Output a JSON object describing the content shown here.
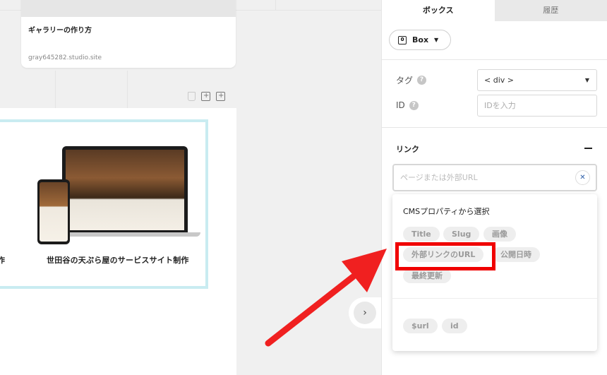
{
  "canvas": {
    "gallery_card": {
      "title": "ギャラリーの作り方",
      "url": "gray645282.studio.site"
    },
    "project": {
      "caption": "世田谷の天ぷら屋のサービスサイト制作",
      "caption_cut": "作"
    },
    "icons": [
      "trash-icon",
      "duplicate-icon",
      "add-icon"
    ],
    "next_button_glyph": "›"
  },
  "panel": {
    "tabs": [
      {
        "label": "ボックス",
        "active": true
      },
      {
        "label": "履歴",
        "active": false
      }
    ],
    "element_type": {
      "icon_glyph": "0",
      "label": "Box"
    },
    "tag": {
      "label": "タグ",
      "value": "< div >"
    },
    "id": {
      "label": "ID",
      "placeholder": "IDを入力"
    },
    "link": {
      "section_title": "リンク",
      "placeholder": "ページまたは外部URL",
      "clear_glyph": "✕"
    },
    "dropdown": {
      "heading": "CMSプロパティから選択",
      "properties": [
        "Title",
        "Slug",
        "画像",
        "外部リンクのURL",
        "公開日時",
        "最終更新"
      ],
      "system": [
        "$url",
        "id"
      ]
    }
  },
  "annotation": {
    "highlight_color": "#f00000",
    "arrow_color": "#f02020"
  }
}
